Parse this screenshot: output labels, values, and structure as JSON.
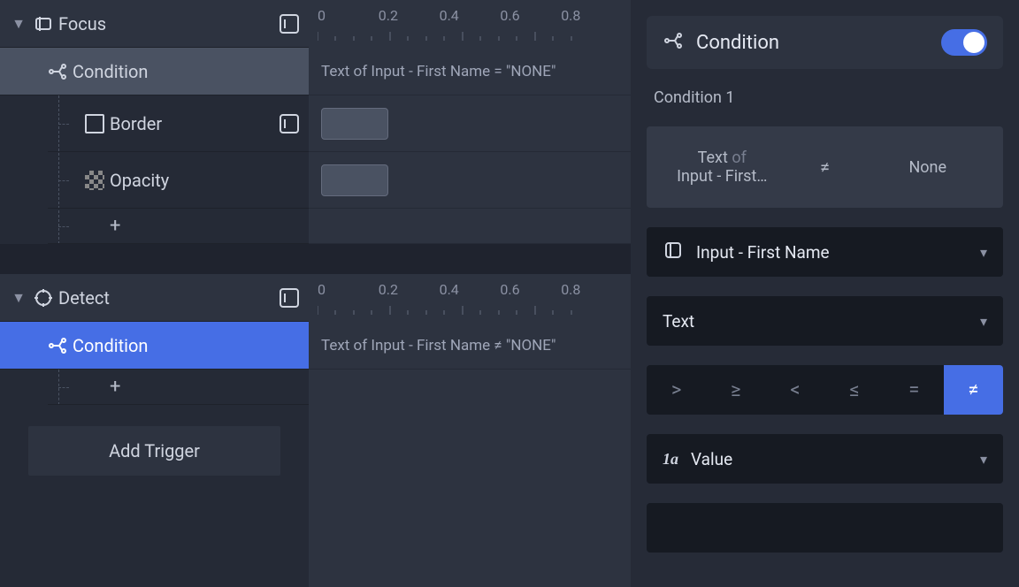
{
  "left": {
    "focus": {
      "label": "Focus",
      "condition_label": "Condition",
      "border_label": "Border",
      "opacity_label": "Opacity",
      "add_symbol": "+"
    },
    "detect": {
      "label": "Detect",
      "condition_label": "Condition",
      "add_symbol": "+"
    },
    "add_trigger": "Add Trigger"
  },
  "mid": {
    "ruler": [
      "0",
      "0.2",
      "0.4",
      "0.6",
      "0.8"
    ],
    "focus_condition_text": "Text of Input - First Name = \"NONE\"",
    "detect_condition_text": "Text of Input - First Name ≠ \"NONE\""
  },
  "right": {
    "header_title": "Condition",
    "condition_number_label": "Condition 1",
    "card": {
      "left_line1_a": "Text",
      "left_line1_b": "of",
      "left_line2": "Input - First…",
      "op": "≠",
      "right": "None"
    },
    "element_select": "Input - First Name",
    "property_select": "Text",
    "operators": [
      ">",
      "≥",
      "<",
      "≤",
      "=",
      "≠"
    ],
    "active_operator_index": 5,
    "value_select": "Value",
    "value_prefix": "1a"
  }
}
